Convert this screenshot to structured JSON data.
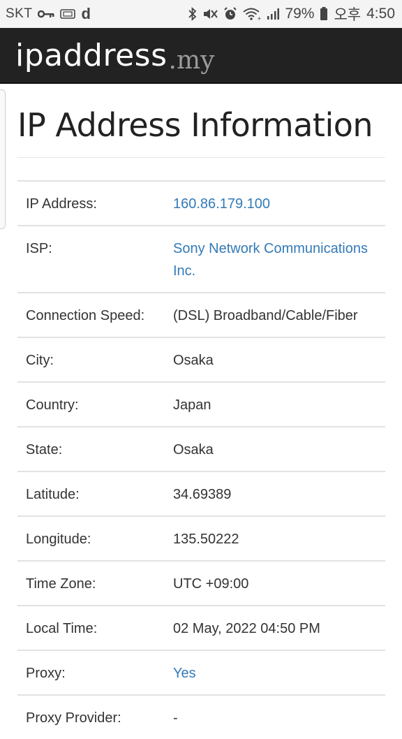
{
  "status_bar": {
    "carrier": "SKT",
    "carrier_app": "d",
    "battery_percent": "79%",
    "ampm": "오후",
    "time": "4:50",
    "icons": [
      "key-icon",
      "sim-icon",
      "bluetooth-icon",
      "mute-icon",
      "alarm-icon",
      "wifi-icon",
      "signal-icon",
      "battery-icon"
    ]
  },
  "navbar": {
    "logo_main": "ipaddress",
    "logo_tld": ".my"
  },
  "page": {
    "title": "IP Address Information"
  },
  "info": {
    "rows": [
      {
        "label": "IP Address:",
        "value": "160.86.179.100",
        "link": true
      },
      {
        "label": "ISP:",
        "value": "Sony Network Communications Inc.",
        "link": true
      },
      {
        "label": "Connection Speed:",
        "value": "(DSL) Broadband/Cable/Fiber",
        "link": false
      },
      {
        "label": "City:",
        "value": "Osaka",
        "link": false
      },
      {
        "label": "Country:",
        "value": "Japan",
        "link": false
      },
      {
        "label": "State:",
        "value": "Osaka",
        "link": false
      },
      {
        "label": "Latitude:",
        "value": "34.69389",
        "link": false
      },
      {
        "label": "Longitude:",
        "value": "135.50222",
        "link": false
      },
      {
        "label": "Time Zone:",
        "value": "UTC +09:00",
        "link": false
      },
      {
        "label": "Local Time:",
        "value": "02 May, 2022 04:50 PM",
        "link": false
      },
      {
        "label": "Proxy:",
        "value": "Yes",
        "link": true
      },
      {
        "label": "Proxy Provider:",
        "value": "-",
        "link": false
      }
    ]
  },
  "colors": {
    "navbar_bg": "#222222",
    "link": "#337ab7",
    "text": "#333333"
  }
}
